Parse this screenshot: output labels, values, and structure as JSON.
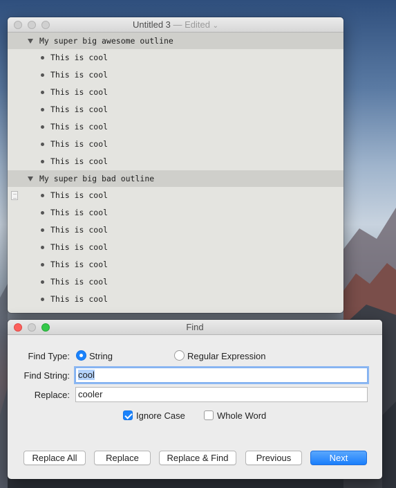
{
  "outline_window": {
    "title": "Untitled 3",
    "title_status": "— Edited",
    "groups": [
      {
        "label": "My super big awesome outline",
        "items": [
          "This is cool",
          "This is cool",
          "This is cool",
          "This is cool",
          "This is cool",
          "This is cool",
          "This is cool"
        ]
      },
      {
        "label": "My super big bad outline",
        "items": [
          "This is cool",
          "This is cool",
          "This is cool",
          "This is cool",
          "This is cool",
          "This is cool",
          "This is cool"
        ]
      }
    ]
  },
  "find_window": {
    "title": "Find",
    "find_type_label": "Find Type:",
    "find_type_options": [
      "String",
      "Regular Expression"
    ],
    "find_type_selected": "String",
    "find_string_label": "Find String:",
    "find_string_value": "cool",
    "replace_label": "Replace:",
    "replace_value": "cooler",
    "ignore_case_label": "Ignore Case",
    "ignore_case_checked": true,
    "whole_word_label": "Whole Word",
    "whole_word_checked": false,
    "buttons": {
      "replace_all": "Replace All",
      "replace": "Replace",
      "replace_find": "Replace & Find",
      "previous": "Previous",
      "next": "Next"
    },
    "accent_color": "#1a82fb"
  }
}
